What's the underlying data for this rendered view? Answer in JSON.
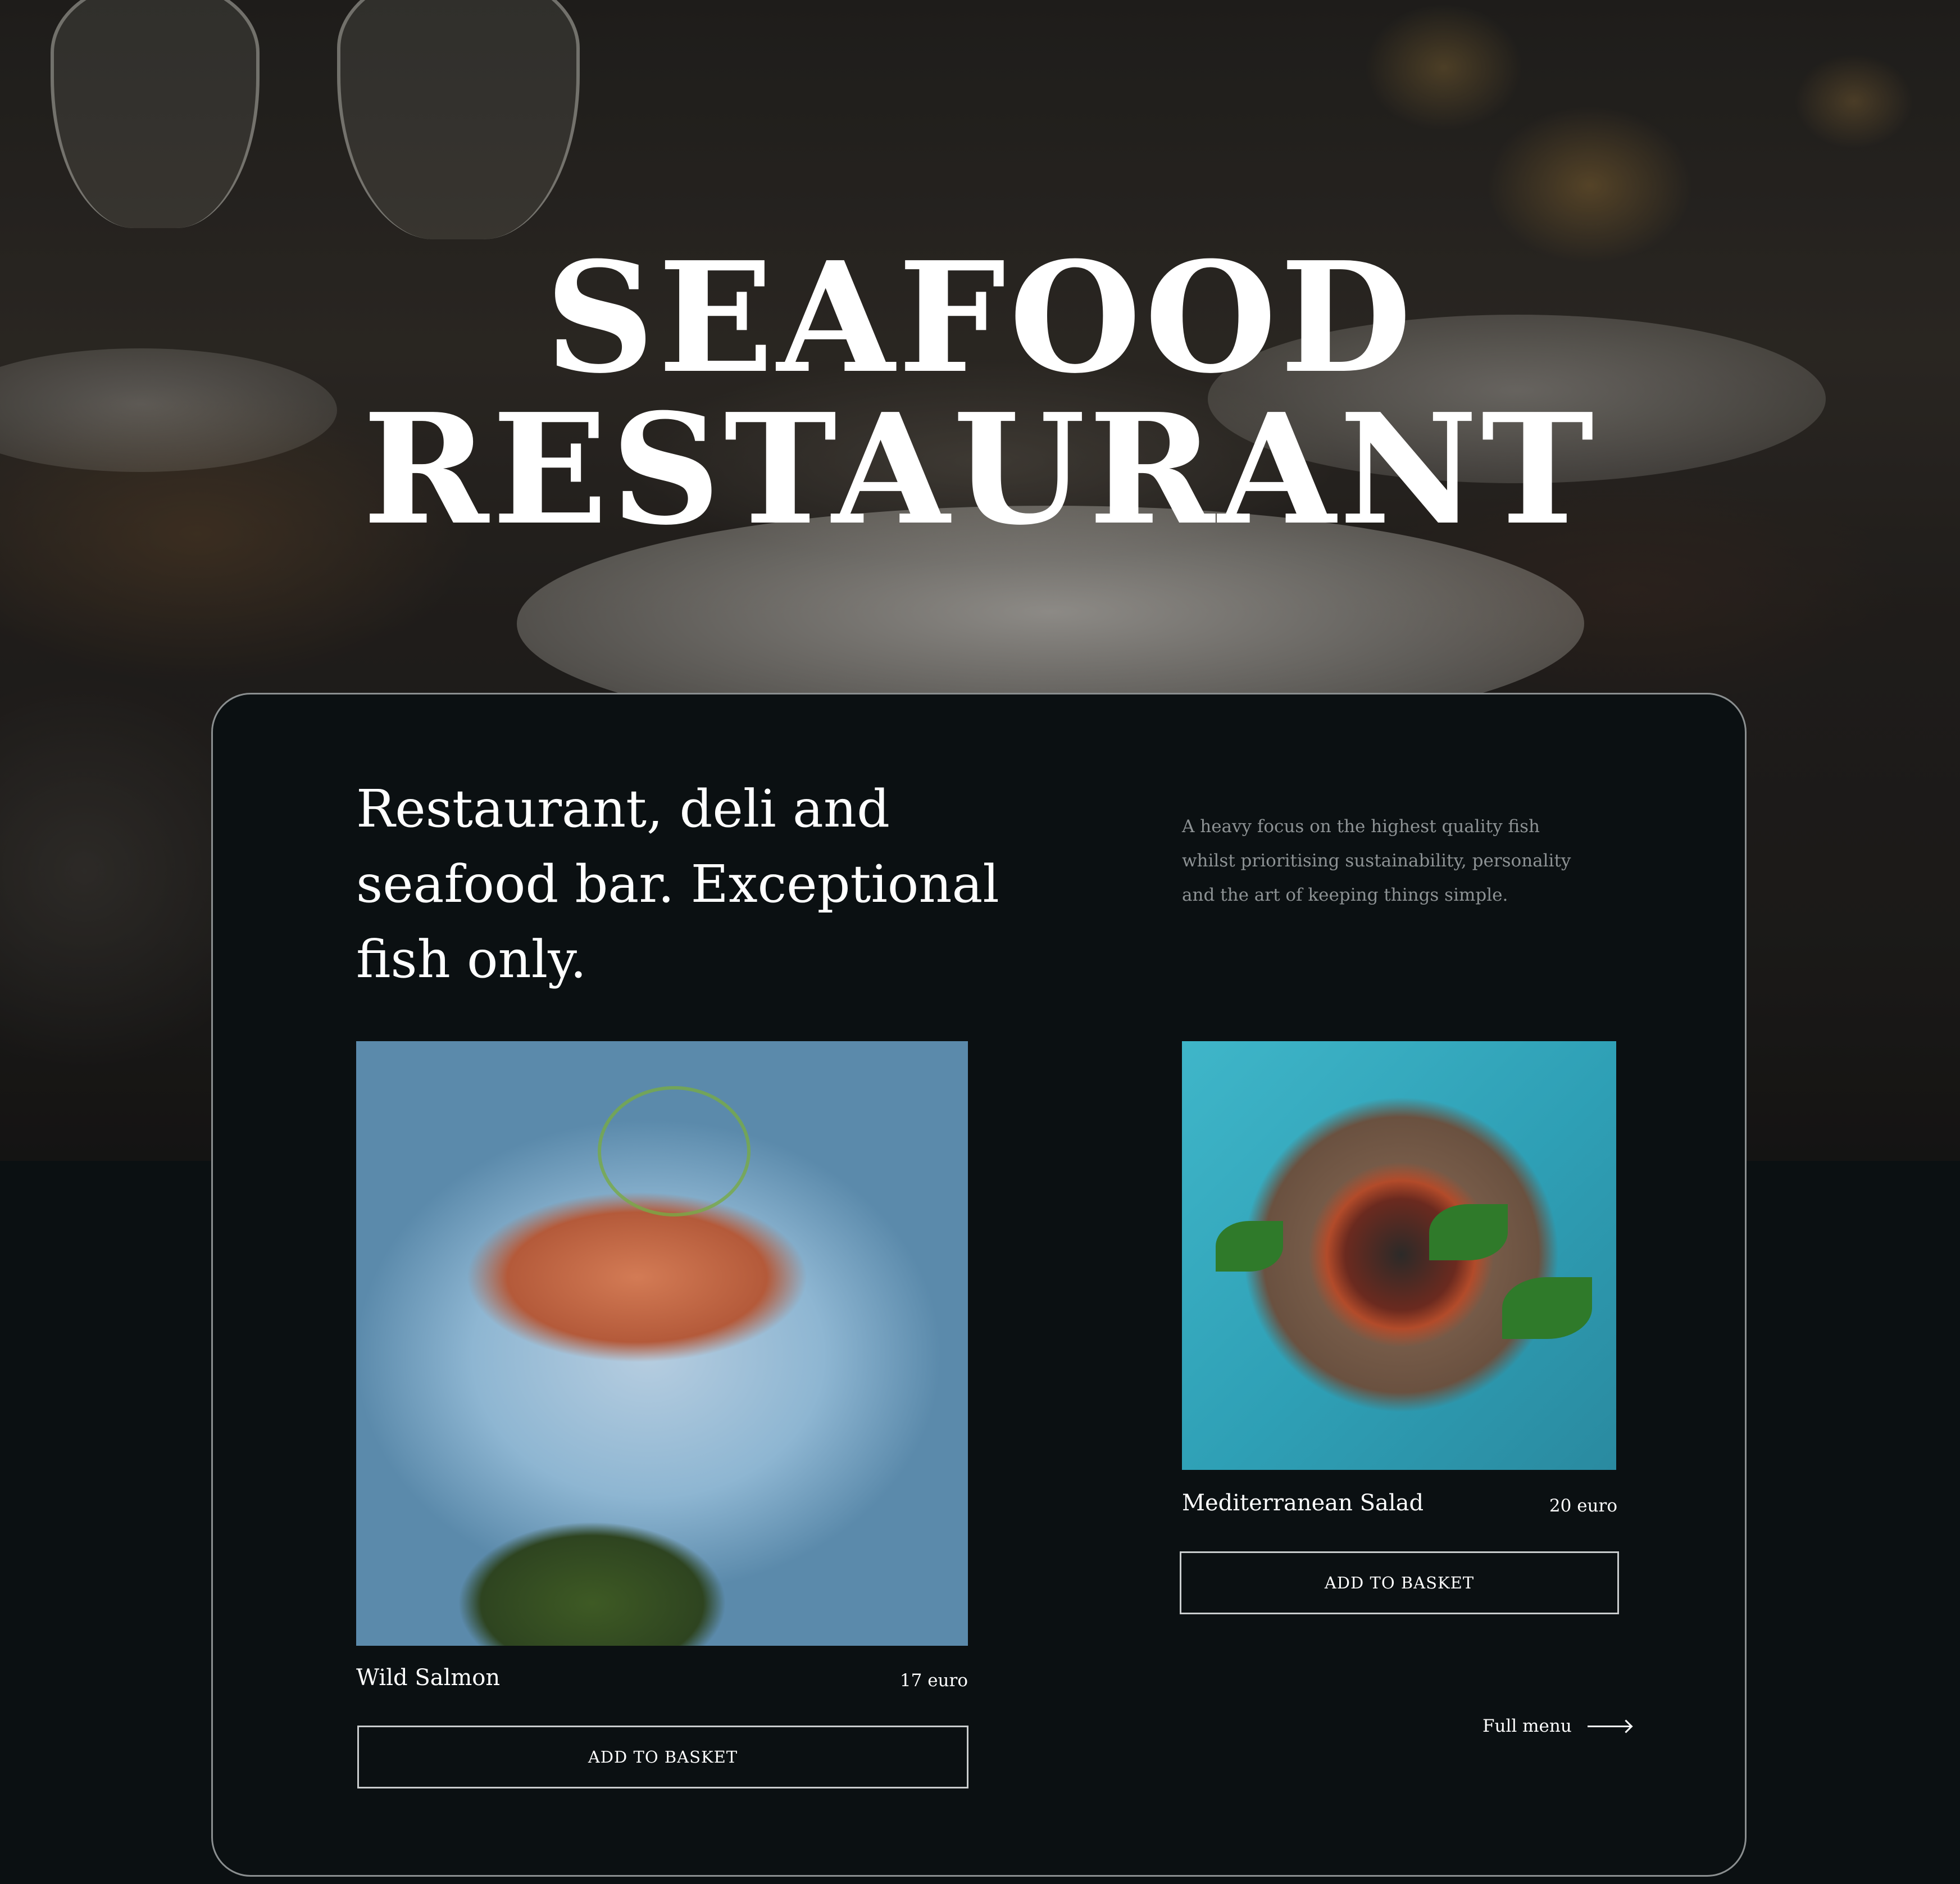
{
  "hero": {
    "title_line1": "SEAFOOD",
    "title_line2": "RESTAURANT"
  },
  "intro_card": {
    "tagline": "Restaurant, deli and seafood bar. Exceptional fish only.",
    "description": "A heavy focus on the highest quality fish whilst prioritising sustainability, personality and the art of keeping things simple."
  },
  "dishes": [
    {
      "name": "Wild Salmon",
      "price": "17 euro",
      "button_label": "ADD TO BASKET",
      "image": "salmon-photo"
    },
    {
      "name": "Mediterranean Salad",
      "price": "20 euro",
      "button_label": "ADD TO BASKET",
      "image": "seafood-salad-photo"
    }
  ],
  "full_menu": {
    "label": "Full menu",
    "icon": "arrow-right-icon"
  },
  "colors": {
    "background": "#0b1012",
    "card_border": "#8b8f90",
    "text": "#ffffff",
    "muted_text": "#8d9294"
  }
}
